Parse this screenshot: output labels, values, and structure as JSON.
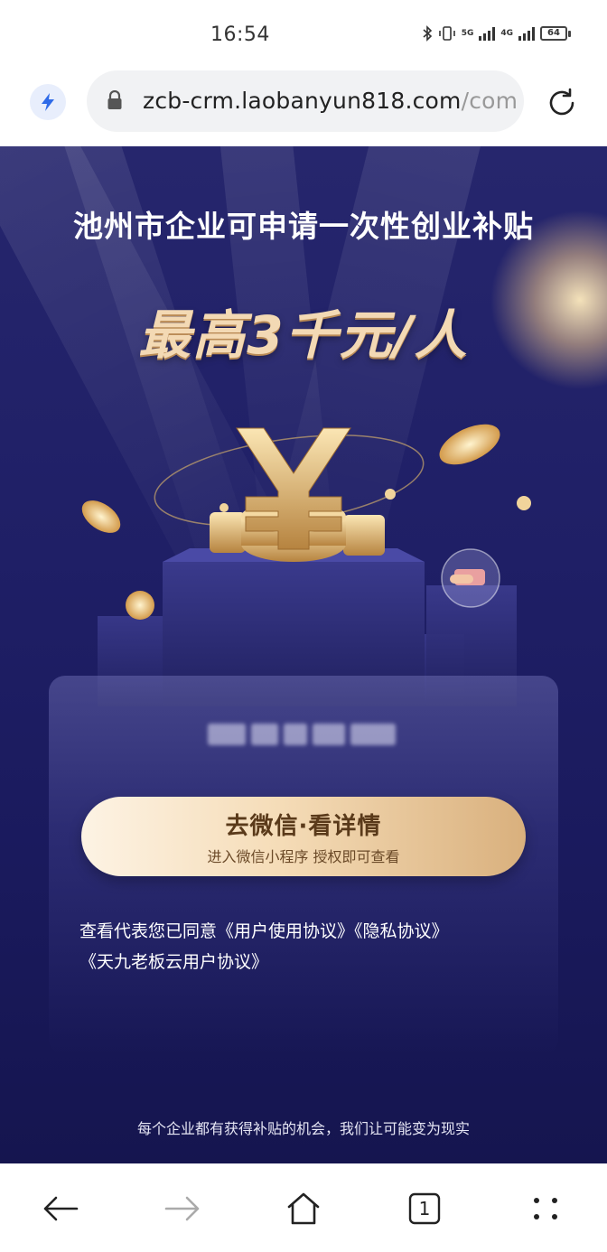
{
  "status_bar": {
    "time": "16:54",
    "network_1": "5G",
    "network_2": "4G",
    "battery": "64"
  },
  "browser": {
    "url_main": "zcb-crm.laobanyun818.com",
    "url_tail": "/com",
    "tab_count": "1",
    "accent_color": "#2f6be8"
  },
  "hero": {
    "title": "池州市企业可申请一次性创业补贴",
    "amount": "最高3千元/人"
  },
  "card": {
    "cta_main": "去微信·看详情",
    "cta_sub": "进入微信小程序 授权即可查看"
  },
  "agreement": {
    "prefix": "查看代表您已同意",
    "link_user": "《用户使用协议》",
    "link_privacy": "《隐私协议》",
    "link_tianjiu": "《天九老板云用户协议》"
  },
  "footer": {
    "slogan": "每个企业都有获得补贴的机会，我们让可能变为现实"
  },
  "icons": {
    "bolt": "bolt-icon",
    "lock": "lock-icon",
    "reload": "reload-icon",
    "back": "back-arrow-icon",
    "forward": "forward-arrow-icon",
    "home": "home-icon",
    "tabs": "tabs-icon",
    "menu": "menu-dots-icon"
  }
}
